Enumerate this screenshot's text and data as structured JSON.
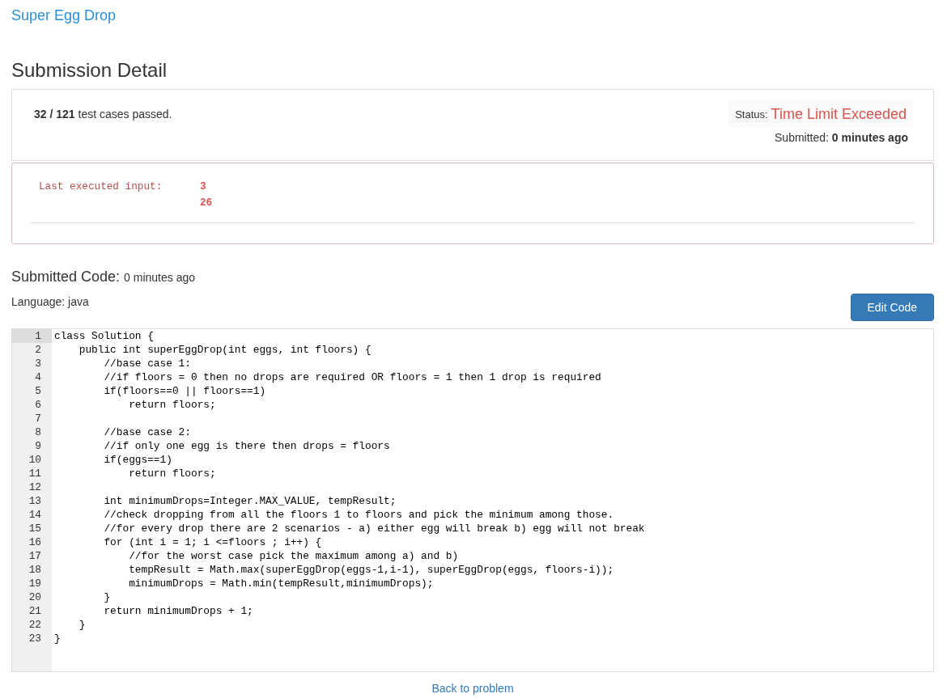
{
  "problem_link": "Super Egg Drop",
  "title": "Submission Detail",
  "result_panel": {
    "summary": "**32 / 121** test cases passed.",
    "status_label": "Status:",
    "status": "Time Limit Exceeded",
    "submitted": "Submitted: **0 minutes ago**"
  },
  "last_input_panel": {
    "label": "Last executed input:",
    "values": [
      "3",
      "26"
    ]
  },
  "submitted_code": {
    "heading": "Submitted Code:",
    "time": "0 minutes ago",
    "language": "Language: java",
    "edit_button": "Edit Code"
  },
  "editor": {
    "lines": [
      {
        "number": "1",
        "text": "class Solution {",
        "active": true
      },
      {
        "number": "2",
        "text": "    public int superEggDrop(int eggs, int floors) {",
        "active": false
      },
      {
        "number": "3",
        "text": "        //base case 1:",
        "active": false
      },
      {
        "number": "4",
        "text": "        //if floors = 0 then no drops are required OR floors = 1 then 1 drop is required",
        "active": false
      },
      {
        "number": "5",
        "text": "        if(floors==0 || floors==1)",
        "active": false
      },
      {
        "number": "6",
        "text": "            return floors;",
        "active": false
      },
      {
        "number": "7",
        "active": false
      },
      {
        "number": "8",
        "text": "        //base case 2:",
        "active": false
      },
      {
        "number": "9",
        "text": "        //if only one egg is there then drops = floors",
        "active": false
      },
      {
        "number": "10",
        "text": "        if(eggs==1)",
        "active": false
      },
      {
        "number": "11",
        "text": "            return floors;",
        "active": false
      },
      {
        "number": "12",
        "active": false
      },
      {
        "number": "13",
        "text": "        int minimumDrops=Integer.MAX_VALUE, tempResult;",
        "active": false
      },
      {
        "number": "14",
        "text": "        //check dropping from all the floors 1 to floors and pick the minimum among those.",
        "active": false
      },
      {
        "number": "15",
        "text": "        //for every drop there are 2 scenarios - a) either egg will break b) egg will not break",
        "active": false
      },
      {
        "number": "16",
        "text": "        for (int i = 1; i <=floors ; i++) {",
        "active": false
      },
      {
        "number": "17",
        "text": "            //for the worst case pick the maximum among a) and b)",
        "active": false
      },
      {
        "number": "18",
        "text": "            tempResult = Math.max(superEggDrop(eggs-1,i-1), superEggDrop(eggs, floors-i));",
        "active": false
      },
      {
        "number": "19",
        "text": "            minimumDrops = Math.min(tempResult,minimumDrops);",
        "active": false
      },
      {
        "number": "20",
        "text": "        }",
        "active": false
      },
      {
        "number": "21",
        "text": "        return minimumDrops + 1;",
        "active": false
      },
      {
        "number": "22",
        "text": "    }",
        "active": false
      },
      {
        "number": "23",
        "text": "}",
        "active": false
      }
    ]
  },
  "back_link": "Back to problem"
}
